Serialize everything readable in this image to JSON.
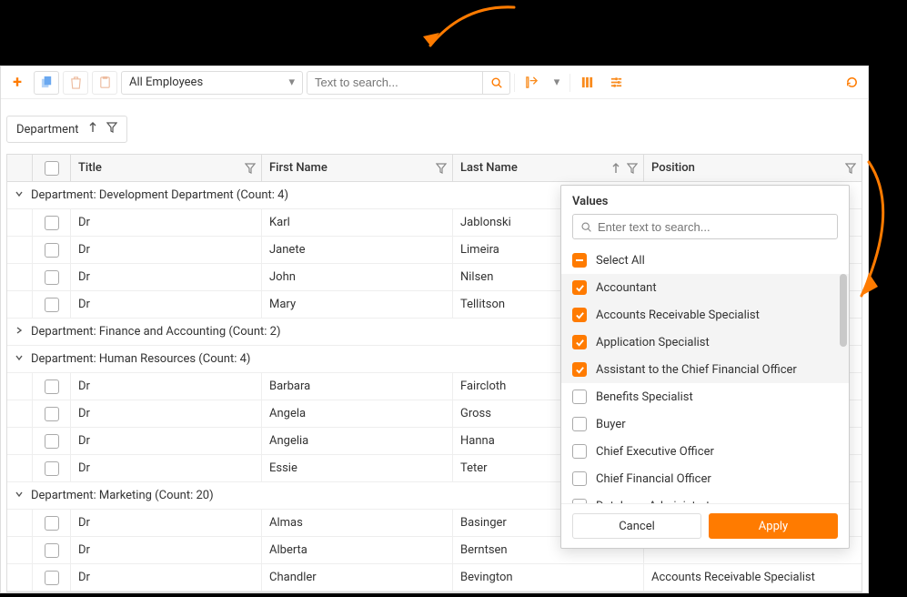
{
  "toolbar": {
    "view_selector": "All Employees",
    "search_placeholder": "Text to search..."
  },
  "group_chip": {
    "label": "Department"
  },
  "columns": {
    "title": "Title",
    "first_name": "First Name",
    "last_name": "Last Name",
    "position": "Position"
  },
  "groups": [
    {
      "expanded": true,
      "label": "Department: Development Department (Count: 4)",
      "rows": [
        {
          "title": "Dr",
          "first": "Karl",
          "last": "Jablonski",
          "position": ""
        },
        {
          "title": "Dr",
          "first": "Janete",
          "last": "Limeira",
          "position": ""
        },
        {
          "title": "Dr",
          "first": "John",
          "last": "Nilsen",
          "position": ""
        },
        {
          "title": "Dr",
          "first": "Mary",
          "last": "Tellitson",
          "position": ""
        }
      ]
    },
    {
      "expanded": false,
      "label": "Department: Finance and Accounting (Count: 2)",
      "rows": []
    },
    {
      "expanded": true,
      "label": "Department: Human Resources (Count: 4)",
      "rows": [
        {
          "title": "Dr",
          "first": "Barbara",
          "last": "Faircloth",
          "position": ""
        },
        {
          "title": "Dr",
          "first": "Angela",
          "last": "Gross",
          "position": ""
        },
        {
          "title": "Dr",
          "first": "Angelia",
          "last": "Hanna",
          "position": ""
        },
        {
          "title": "Dr",
          "first": "Essie",
          "last": "Teter",
          "position": ""
        }
      ]
    },
    {
      "expanded": true,
      "label": "Department: Marketing (Count: 20)",
      "rows": [
        {
          "title": "Dr",
          "first": "Almas",
          "last": "Basinger",
          "position": ""
        },
        {
          "title": "Dr",
          "first": "Alberta",
          "last": "Berntsen",
          "position": ""
        },
        {
          "title": "Dr",
          "first": "Chandler",
          "last": "Bevington",
          "position": "Accounts Receivable Specialist"
        }
      ]
    }
  ],
  "filter_popup": {
    "title": "Values",
    "search_placeholder": "Enter text to search...",
    "select_all": "Select All",
    "items": [
      {
        "label": "Accountant",
        "checked": true
      },
      {
        "label": "Accounts Receivable Specialist",
        "checked": true
      },
      {
        "label": "Application Specialist",
        "checked": true
      },
      {
        "label": "Assistant to the Chief Financial Officer",
        "checked": true
      },
      {
        "label": "Benefits Specialist",
        "checked": false
      },
      {
        "label": "Buyer",
        "checked": false
      },
      {
        "label": "Chief Executive Officer",
        "checked": false
      },
      {
        "label": "Chief Financial Officer",
        "checked": false
      },
      {
        "label": "Database Administrator",
        "checked": false
      }
    ],
    "cancel": "Cancel",
    "apply": "Apply"
  }
}
